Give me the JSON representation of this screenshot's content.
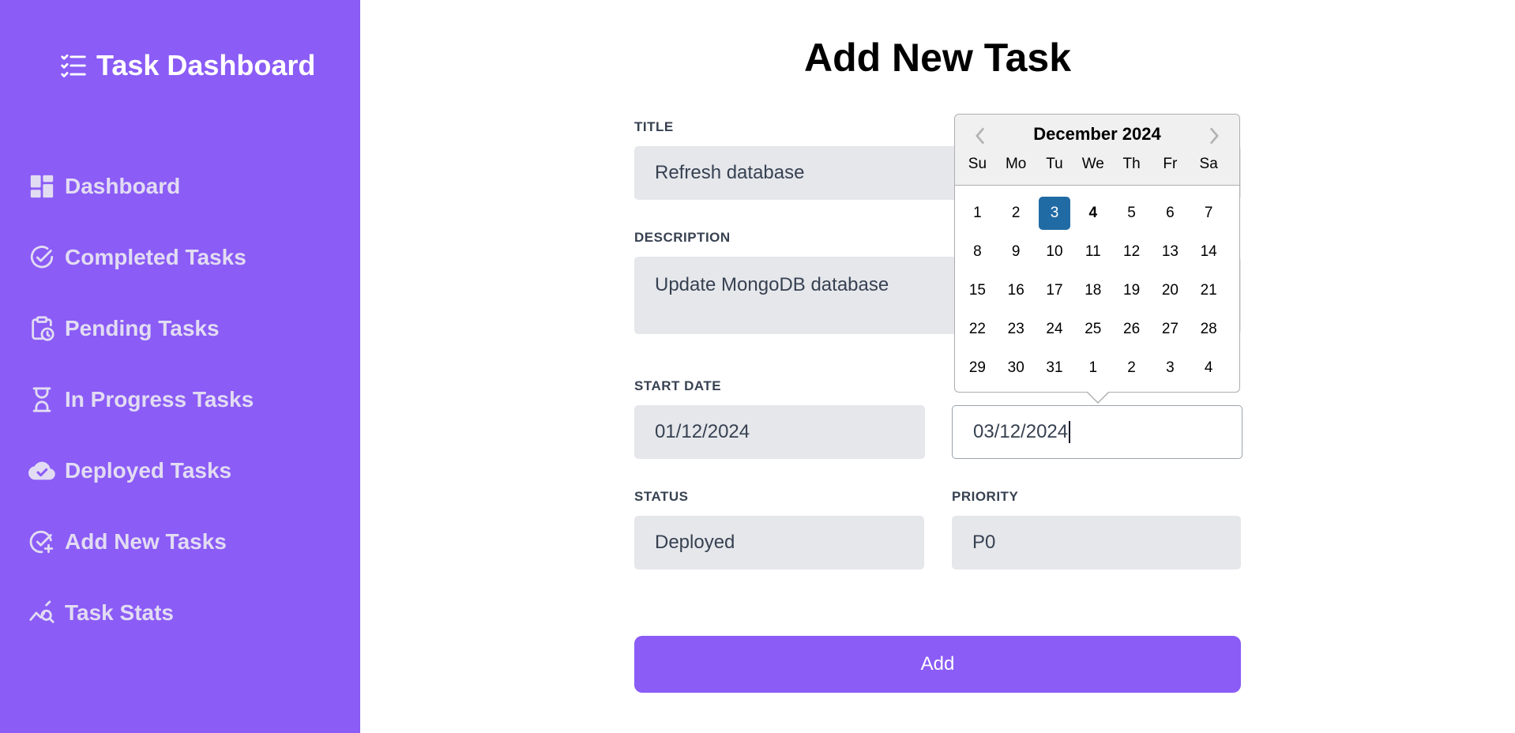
{
  "sidebar": {
    "brand": "Task Dashboard",
    "items": [
      {
        "label": "Dashboard",
        "icon": "dashboard-icon"
      },
      {
        "label": "Completed Tasks",
        "icon": "check-circle-icon"
      },
      {
        "label": "Pending Tasks",
        "icon": "clipboard-clock-icon"
      },
      {
        "label": "In Progress Tasks",
        "icon": "hourglass-icon"
      },
      {
        "label": "Deployed Tasks",
        "icon": "cloud-check-icon"
      },
      {
        "label": "Add New Tasks",
        "icon": "check-plus-icon"
      },
      {
        "label": "Task Stats",
        "icon": "chart-search-icon"
      }
    ]
  },
  "colors": {
    "sidebar_bg": "#8b5cf6",
    "accent": "#8b5cf6",
    "field_bg": "#e5e7eb",
    "selected_day": "#216ba5"
  },
  "page": {
    "title": "Add New Task"
  },
  "form": {
    "title_label": "TITLE",
    "title_value": "Refresh database",
    "description_label": "DESCRIPTION",
    "description_value": "Update MongoDB database",
    "start_date_label": "START DATE",
    "start_date_value": "01/12/2024",
    "end_date_value": "03/12/2024",
    "status_label": "STATUS",
    "status_value": "Deployed",
    "priority_label": "PRIORITY",
    "priority_value": "P0",
    "submit_label": "Add"
  },
  "datepicker": {
    "month_label": "December 2024",
    "weekdays": [
      "Su",
      "Mo",
      "Tu",
      "We",
      "Th",
      "Fr",
      "Sa"
    ],
    "weeks": [
      [
        "1",
        "2",
        "3",
        "4",
        "5",
        "6",
        "7"
      ],
      [
        "8",
        "9",
        "10",
        "11",
        "12",
        "13",
        "14"
      ],
      [
        "15",
        "16",
        "17",
        "18",
        "19",
        "20",
        "21"
      ],
      [
        "22",
        "23",
        "24",
        "25",
        "26",
        "27",
        "28"
      ],
      [
        "29",
        "30",
        "31",
        "1",
        "2",
        "3",
        "4"
      ]
    ],
    "selected_day": "3",
    "today_day": "4"
  }
}
